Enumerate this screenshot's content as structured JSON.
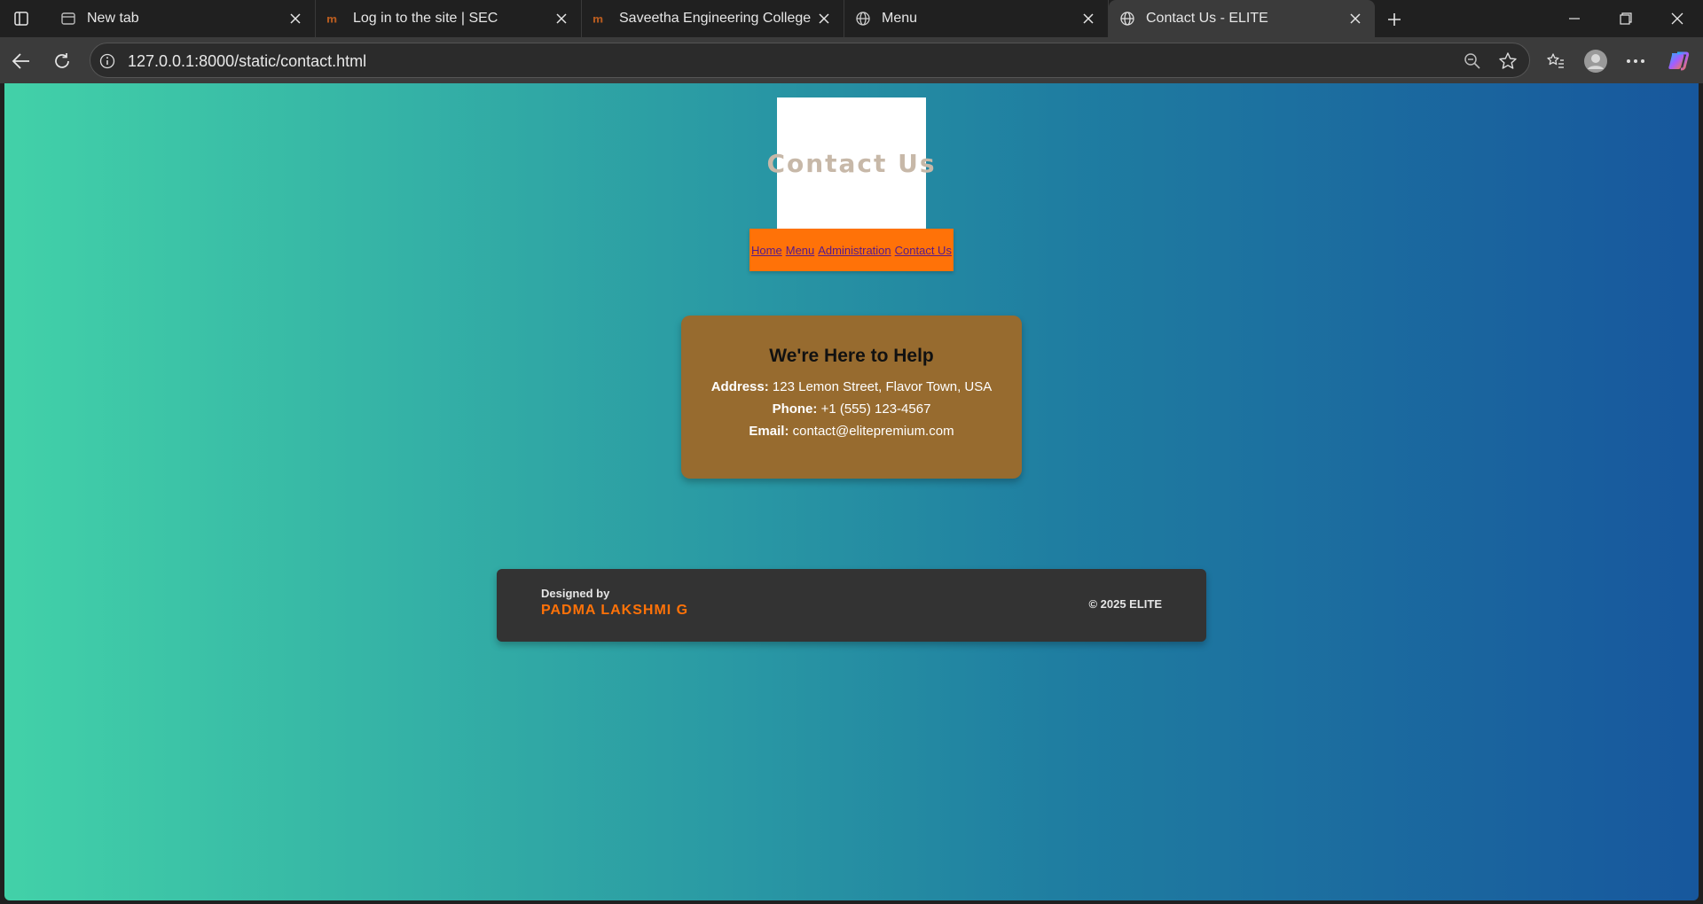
{
  "browser": {
    "tabs": [
      {
        "title": "New tab",
        "icon": "newtab-page-icon"
      },
      {
        "title": "Log in to the site | SEC",
        "icon": "moodle-icon"
      },
      {
        "title": "Saveetha Engineering College: Lo",
        "icon": "moodle-icon"
      },
      {
        "title": "Menu",
        "icon": "globe-icon"
      },
      {
        "title": "Contact Us - ELITE",
        "icon": "globe-icon"
      }
    ],
    "active_tab": 4,
    "address_bar": {
      "url": "127.0.0.1:8000/static/contact.html"
    }
  },
  "page": {
    "logo_text": "Contact Us",
    "nav": {
      "home": "Home",
      "menu": "Menu",
      "administration": "Administration",
      "contact": "Contact Us"
    },
    "card": {
      "heading": "We're Here to Help",
      "address_label": "Address:",
      "address_value": "123 Lemon Street, Flavor Town, USA",
      "phone_label": "Phone:",
      "phone_value": "+1 (555) 123-4567",
      "email_label": "Email:",
      "email_value": "contact@elitepremium.com"
    },
    "footer": {
      "designed_by": "Designed by",
      "designer": "PADMA LAKSHMI G",
      "copyright": "© 2025 ELITE"
    }
  },
  "colors": {
    "nav_bg": "#ff7208",
    "card_bg": "#976b2f",
    "footer_bg": "#333333",
    "designer_accent": "#ff7208",
    "gradient_start": "#42d1a8",
    "gradient_end": "#17579d"
  }
}
